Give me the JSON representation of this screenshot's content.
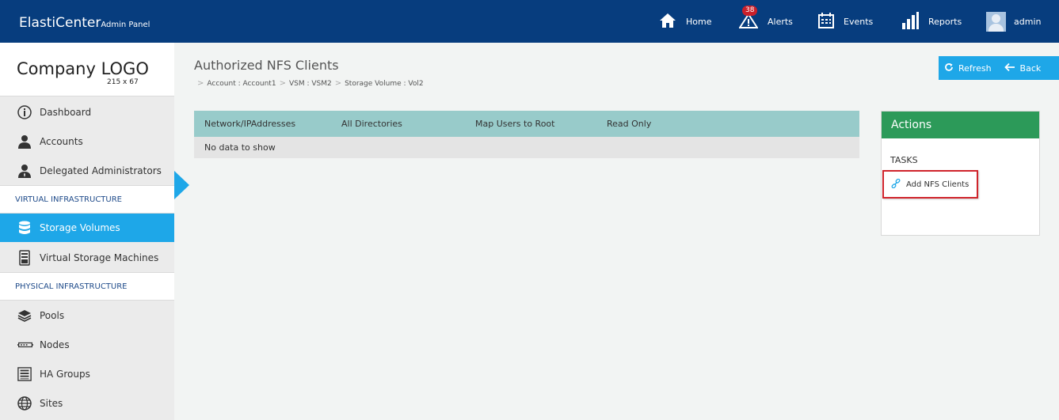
{
  "header": {
    "brand": "ElastiCenter",
    "brand_sub": "Admin Panel",
    "nav": {
      "home": "Home",
      "alerts": "Alerts",
      "alerts_count": "38",
      "events": "Events",
      "reports": "Reports",
      "user": "admin"
    }
  },
  "sidebar": {
    "logo": "Company LOGO",
    "logo_size": "215 x 67",
    "items": {
      "dashboard": "Dashboard",
      "accounts": "Accounts",
      "delegated": "Delegated Administrators",
      "storage_volumes": "Storage Volumes",
      "vsm": "Virtual Storage Machines",
      "pools": "Pools",
      "nodes": "Nodes",
      "ha_groups": "HA Groups",
      "sites": "Sites"
    },
    "sections": {
      "virtual": "VIRTUAL INFRASTRUCTURE",
      "physical": "PHYSICAL INFRASTRUCTURE"
    }
  },
  "main": {
    "title": "Authorized NFS Clients",
    "breadcrumb": [
      "Account : Account1",
      "VSM : VSM2",
      "Storage Volume : Vol2"
    ],
    "buttons": {
      "refresh": "Refresh",
      "back": "Back"
    },
    "table": {
      "columns": [
        "Network/IPAddresses",
        "All Directories",
        "Map Users to Root",
        "Read Only"
      ],
      "empty": "No data to show"
    }
  },
  "actions": {
    "title": "Actions",
    "tasks_label": "TASKS",
    "add_nfs": "Add NFS Clients"
  },
  "colors": {
    "topbar": "#073d7e",
    "accent": "#1ea7e8",
    "actions_header": "#2c9a59",
    "table_header": "#98cbca",
    "highlight_border": "#d0242b"
  }
}
